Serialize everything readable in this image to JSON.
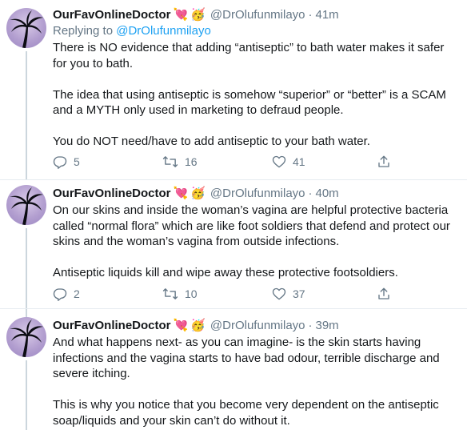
{
  "tweets": [
    {
      "name": "OurFavOnlineDoctor",
      "emoji1": "💘",
      "emoji2": "🥳",
      "handle": "@DrOlufunmilayo",
      "dot": "·",
      "time": "41m",
      "replying_prefix": "Replying to ",
      "replying_to": "@DrOlufunmilayo",
      "paragraphs": [
        "There is NO evidence that adding “antiseptic” to bath water makes it safer for you to bath.",
        "The idea that using antiseptic is somehow “superior” or “better” is a SCAM and a MYTH only used in marketing to defraud people.",
        "You do NOT need/have to add antiseptic to your bath water."
      ],
      "replies": "5",
      "retweets": "16",
      "likes": "41"
    },
    {
      "name": "OurFavOnlineDoctor",
      "emoji1": "💘",
      "emoji2": "🥳",
      "handle": "@DrOlufunmilayo",
      "dot": "·",
      "time": "40m",
      "paragraphs": [
        "On our skins and inside the woman’s vagina are helpful protective bacteria called “normal flora” which are like foot soldiers that defend and protect our skins and the woman’s vagina from outside infections.",
        "Antiseptic liquids kill and wipe away these protective footsoldiers."
      ],
      "replies": "2",
      "retweets": "10",
      "likes": "37"
    },
    {
      "name": "OurFavOnlineDoctor",
      "emoji1": "💘",
      "emoji2": "🥳",
      "handle": "@DrOlufunmilayo",
      "dot": "·",
      "time": "39m",
      "paragraphs": [
        "And what happens next- as you can imagine- is the skin starts having infections and the vagina starts to have bad odour, terrible discharge and severe itching.",
        "This is why you notice that you become very dependent on the antiseptic soap/liquids and your skin can’t do without it."
      ]
    }
  ],
  "icons": {
    "reply": "reply-icon",
    "retweet": "retweet-icon",
    "like": "heart-icon",
    "share": "share-icon",
    "avatar": "palm-tree-avatar"
  },
  "colors": {
    "accent": "#1da1f2",
    "muted": "#657786",
    "text": "#14171a",
    "avatar": "#b39fd0"
  }
}
